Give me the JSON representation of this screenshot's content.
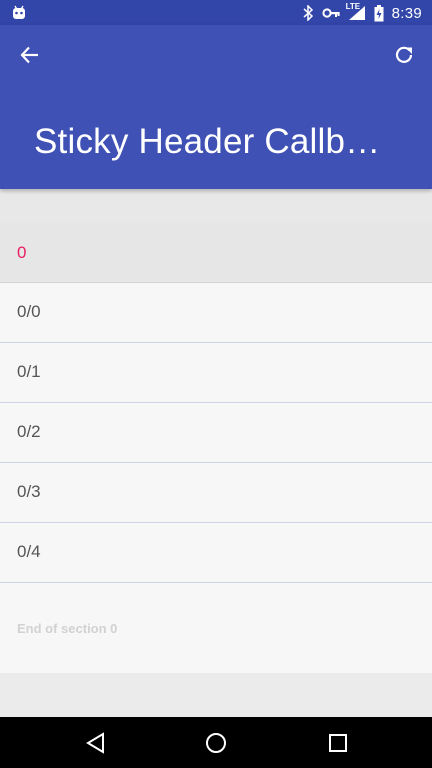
{
  "status_bar": {
    "time": "8:39",
    "network_label": "LTE",
    "icons": [
      "android-notification-icon",
      "bluetooth-icon",
      "vpn-key-icon",
      "signal-icon",
      "battery-icon"
    ]
  },
  "app_bar": {
    "title": "Sticky Header Callba…",
    "back_icon": "arrow-back-icon",
    "refresh_icon": "refresh-icon",
    "color": "#3f51b5",
    "status_color": "#3245a8"
  },
  "list": {
    "section_header": "0",
    "items": [
      "0/0",
      "0/1",
      "0/2",
      "0/3",
      "0/4"
    ],
    "footer": "End of section 0",
    "header_color": "#e91e63"
  },
  "nav_bar": {
    "icons": [
      "nav-back-icon",
      "nav-home-icon",
      "nav-recents-icon"
    ]
  }
}
